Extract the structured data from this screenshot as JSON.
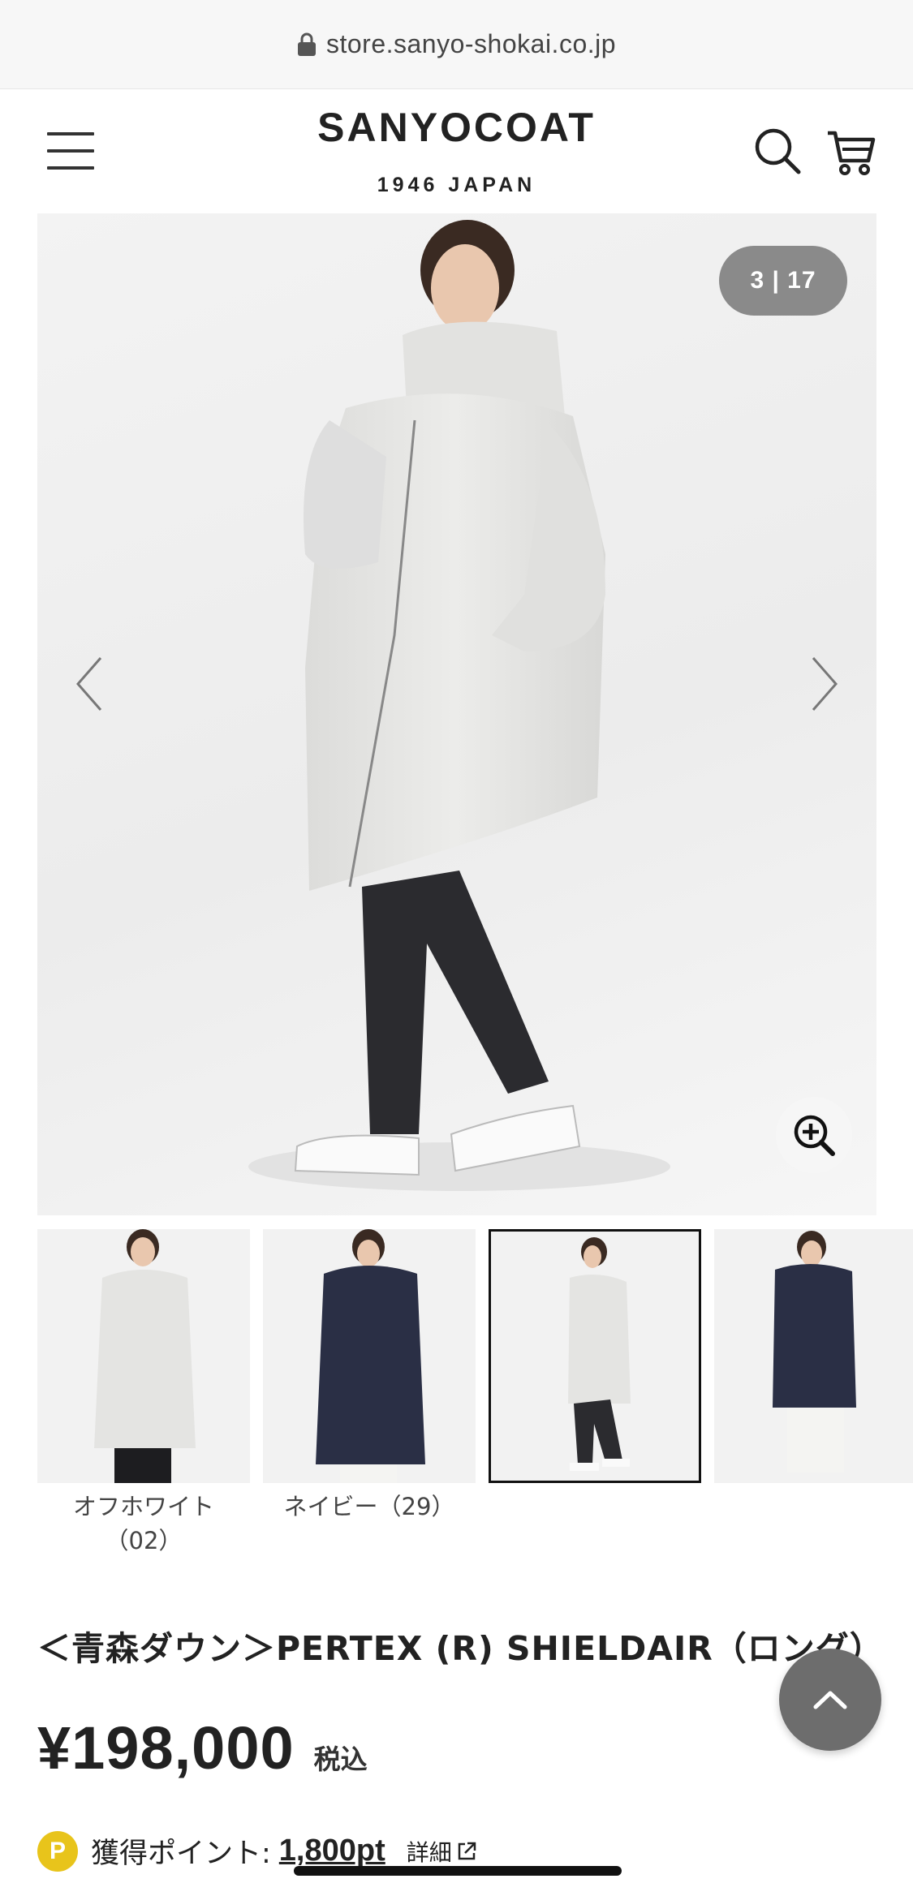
{
  "browser": {
    "url": "store.sanyo-shokai.co.jp"
  },
  "header": {
    "brand": "SANYOCOAT",
    "sub": "1946 JAPAN"
  },
  "gallery": {
    "counter": "3 | 17",
    "current_index": 3,
    "total": 17
  },
  "thumbnails": [
    {
      "label": "オフホワイト\n（02）",
      "coat_color": "#e4e4e2",
      "selected": false
    },
    {
      "label": "ネイビー（29）",
      "coat_color": "#2a2f45",
      "selected": false
    },
    {
      "label": "",
      "coat_color": "#e4e4e2",
      "selected": true
    },
    {
      "label": "",
      "coat_color": "#2a2f45",
      "selected": false
    }
  ],
  "product": {
    "title": "＜青森ダウン＞PERTEX (R) SHIELDAIR（ロング）",
    "price": "¥198,000",
    "tax_label": "税込",
    "points_badge": "P",
    "points_label": "獲得ポイント:",
    "points_value": "1,800pt",
    "points_detail": "詳細"
  },
  "colors": {
    "counter_bg": "#8a8a8a",
    "points_badge": "#e8c41b",
    "scroll_top_bg": "#6d6d6d"
  }
}
